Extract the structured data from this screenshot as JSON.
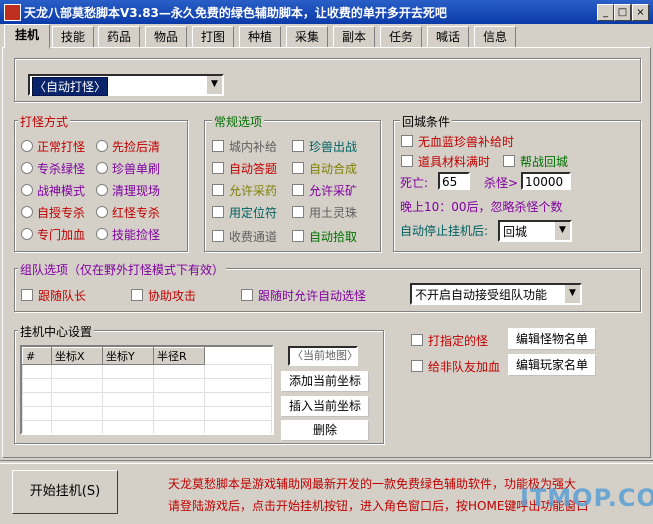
{
  "window": {
    "title": "天龙八部莫愁脚本V3.83—永久免费的绿色辅助脚本，让收费的单开多开去死吧",
    "min_label": "_",
    "max_label": "□",
    "close_label": "×"
  },
  "tabs": [
    "挂机",
    "技能",
    "药品",
    "物品",
    "打图",
    "种植",
    "采集",
    "副本",
    "任务",
    "喊话",
    "信息"
  ],
  "mode_select": {
    "value": "〈自动打怪〉"
  },
  "fight_mode": {
    "title": "打怪方式",
    "options": [
      "正常打怪",
      "先捡后清",
      "专杀绿怪",
      "珍兽单刷",
      "战神模式",
      "清理现场",
      "自授专杀",
      "红怪专杀",
      "专门加血",
      "技能捡怪"
    ]
  },
  "general": {
    "title": "常规选项",
    "options": [
      "城内补给",
      "珍兽出战",
      "自动答题",
      "自动合成",
      "允许采药",
      "允许采矿",
      "用定位符",
      "用土灵珠",
      "收费通道",
      "自动拾取"
    ]
  },
  "return_city": {
    "title": "回城条件",
    "opt1": "无血蓝珍兽补给时",
    "opt2": "道具材料满时",
    "opt3": "帮战回城",
    "death_label": "死亡:",
    "death_value": "65",
    "kill_label": "杀怪>",
    "kill_value": "10000",
    "night_note": "晚上10：00后，忽略杀怪个数",
    "auto_stop_label": "自动停止挂机后:",
    "auto_stop_value": "回城"
  },
  "team": {
    "title": "组队选项（仅在野外打怪模式下有效）",
    "follow": "跟随队长",
    "assist": "协助攻击",
    "allow_auto": "跟随时允许自动选怪",
    "team_select": "不开启自动接受组队功能"
  },
  "center": {
    "title": "挂机中心设置",
    "columns": [
      "#",
      "坐标X",
      "坐标Y",
      "半径R"
    ],
    "map_placeholder": "〈当前地图〉",
    "add_btn": "添加当前坐标",
    "insert_btn": "插入当前坐标",
    "delete_btn": "删除"
  },
  "target": {
    "hit_specific": "打指定的怪",
    "edit_monster": "编辑怪物名单",
    "heal_nonteam": "给非队友加血",
    "edit_player": "编辑玩家名单"
  },
  "footer": {
    "start_btn": "开始挂机(S)",
    "desc1": "天龙莫愁脚本是游戏辅助网最新开发的一款免费绿色辅助软件，功能极为强大",
    "desc2": "请登陆游戏后，点击开始挂机按钮，进入角色窗口后，按HOME键呼出功能窗口",
    "watermark": "ITMOP.COM"
  }
}
